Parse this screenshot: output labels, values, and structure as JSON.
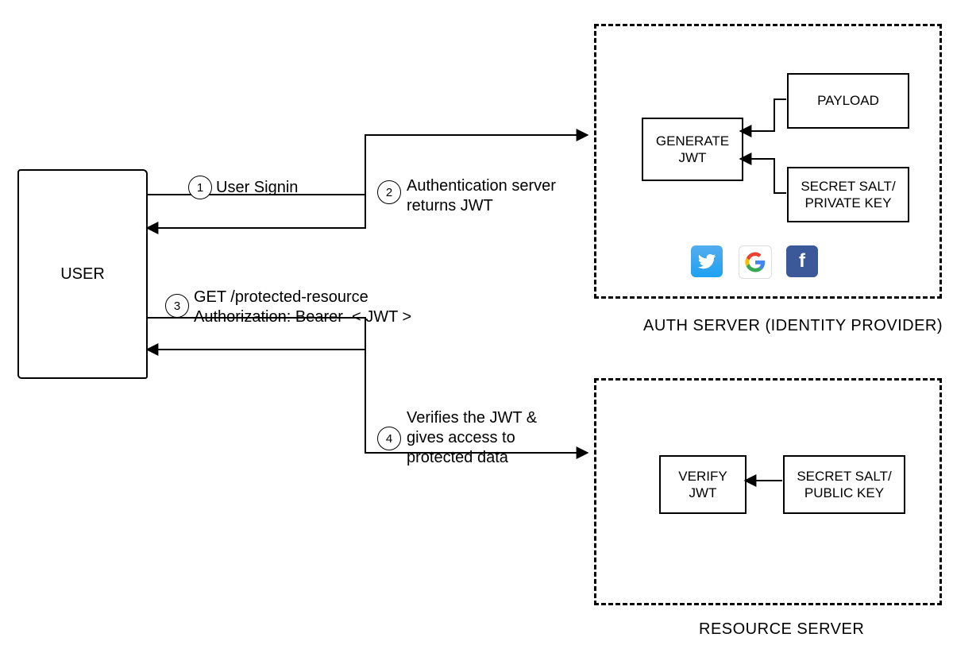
{
  "user_box": {
    "label": "USER"
  },
  "steps": {
    "s1": {
      "num": "1",
      "label": "User Signin"
    },
    "s2": {
      "num": "2",
      "label": "Authentication server\nreturns JWT"
    },
    "s3": {
      "num": "3",
      "label": "GET /protected-resource\nAuthorization: Bearer  < JWT >"
    },
    "s4": {
      "num": "4",
      "label": "Verifies the JWT &\ngives access to\nprotected data"
    }
  },
  "auth_server": {
    "title": "AUTH SERVER (IDENTITY PROVIDER)",
    "generate_jwt": "GENERATE\nJWT",
    "payload": "PAYLOAD",
    "secret": "SECRET SALT/\nPRIVATE KEY",
    "icons": {
      "twitter": "twitter-icon",
      "google": "google-icon",
      "facebook": "facebook-icon"
    }
  },
  "resource_server": {
    "title": "RESOURCE SERVER",
    "verify_jwt": "VERIFY\nJWT",
    "secret": "SECRET SALT/\nPUBLIC KEY"
  }
}
